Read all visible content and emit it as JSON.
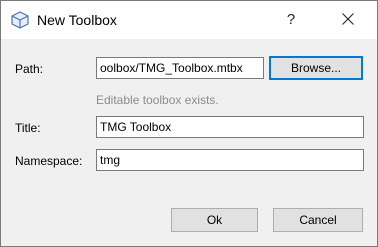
{
  "window": {
    "title": "New Toolbox",
    "help_glyph": "?",
    "icon": "toolbox-icon"
  },
  "form": {
    "path_label": "Path:",
    "path_value": "oolbox/TMG_Toolbox.mtbx",
    "browse_label": "Browse...",
    "hint": "Editable toolbox exists.",
    "title_label": "Title:",
    "title_value": "TMG Toolbox",
    "namespace_label": "Namespace:",
    "namespace_value": "tmg"
  },
  "buttons": {
    "ok": "Ok",
    "cancel": "Cancel"
  },
  "colors": {
    "focus_accent": "#0078d7",
    "hint_text": "#8c8c8c"
  }
}
